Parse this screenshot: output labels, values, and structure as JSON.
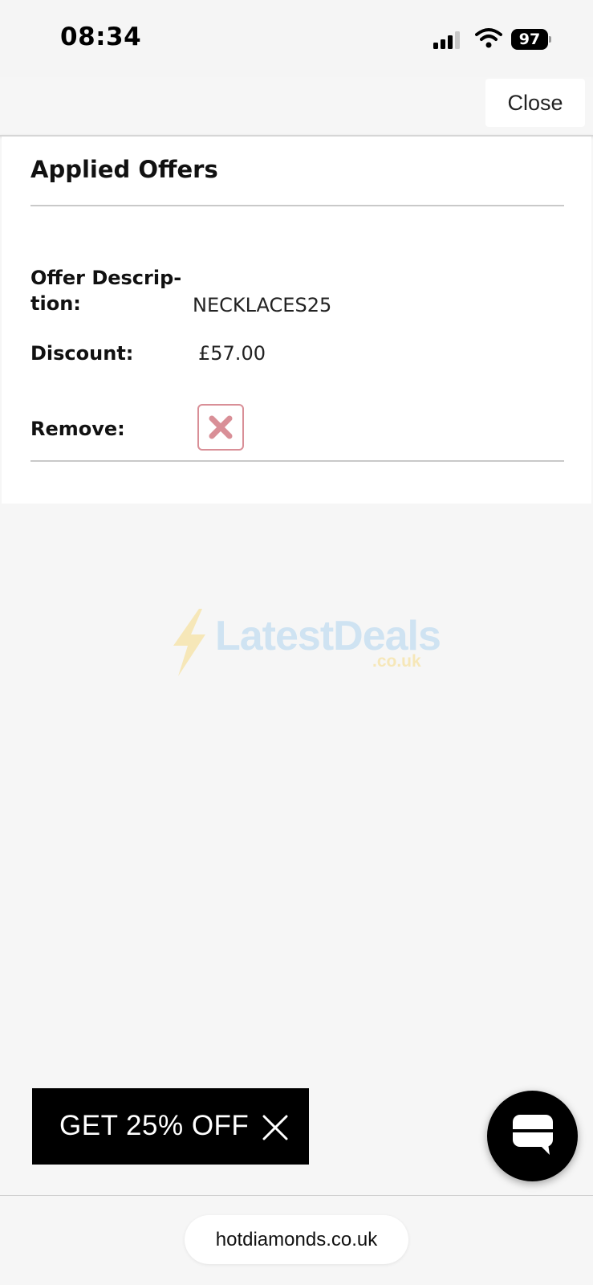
{
  "status_bar": {
    "time": "08:34",
    "battery_level": "97",
    "signal_bars": 3,
    "wifi": "wifi-icon"
  },
  "header": {
    "close_label": "Close"
  },
  "applied_offers": {
    "title": "Applied Offers",
    "offer_description_label_line1": "Offer Descrip-",
    "offer_description_label_line2": "tion:",
    "offer_description_value": "NECKLACES25",
    "discount_label": "Discount:",
    "discount_value": "£57.00",
    "remove_label": "Remove:",
    "remove_icon": "x-icon",
    "remove_color": "#d98f97"
  },
  "watermark": {
    "brand": "LatestDeals",
    "domain": ".co.uk"
  },
  "promo": {
    "label": "GET 25% OFF",
    "close_icon": "close-icon",
    "background": "#000000"
  },
  "chat": {
    "icon": "chat-icon"
  },
  "browser": {
    "url": "hotdiamonds.co.uk"
  }
}
